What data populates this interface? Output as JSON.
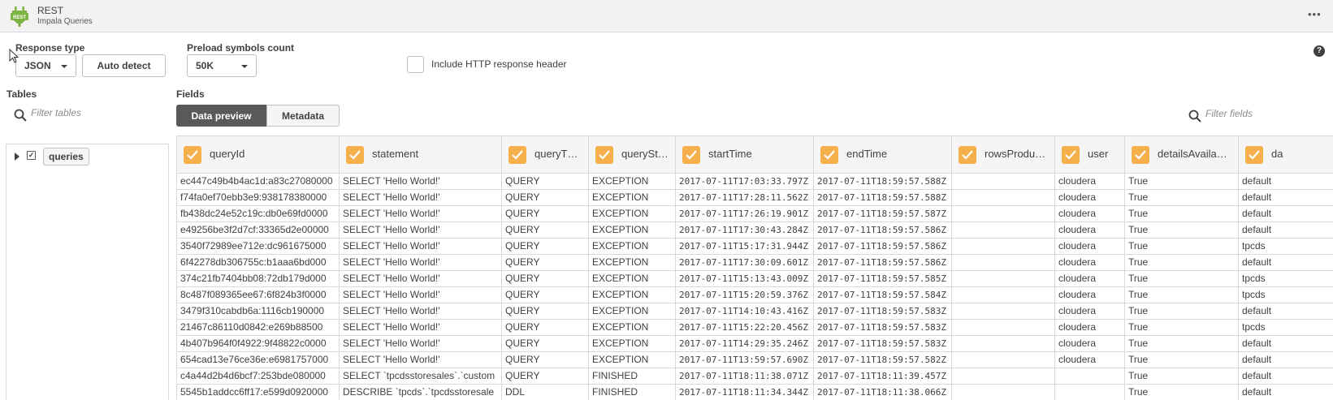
{
  "app": {
    "logo_text": "REST",
    "title": "REST",
    "subtitle": "Impala Queries",
    "more": "•••"
  },
  "options": {
    "response_type_label": "Response type",
    "response_type_value": "JSON",
    "auto_detect_label": "Auto detect",
    "preload_label": "Preload symbols count",
    "preload_value": "50K",
    "include_header_label": "Include HTTP response header",
    "help": "?"
  },
  "tables": {
    "label": "Tables",
    "filter_placeholder": "Filter tables",
    "items": [
      {
        "name": "queries",
        "checked_mark": "✓"
      }
    ]
  },
  "fields": {
    "label": "Fields",
    "tabs": [
      "Data preview",
      "Metadata"
    ],
    "filter_placeholder": "Filter fields",
    "columns": [
      "queryId",
      "statement",
      "queryT…",
      "querySt…",
      "startTime",
      "endTime",
      "rowsProdu…",
      "user",
      "detailsAvaila…",
      "da"
    ],
    "rows": [
      [
        "ec447c49b4b4ac1d:a83c27080000",
        "SELECT 'Hello World!'",
        "QUERY",
        "EXCEPTION",
        "2017-07-11T17:03:33.797Z",
        "2017-07-11T18:59:57.588Z",
        "",
        "cloudera",
        "True",
        "default"
      ],
      [
        "f74fa0ef70ebb3e9:938178380000",
        "SELECT 'Hello World!'",
        "QUERY",
        "EXCEPTION",
        "2017-07-11T17:28:11.562Z",
        "2017-07-11T18:59:57.588Z",
        "",
        "cloudera",
        "True",
        "default"
      ],
      [
        "fb438dc24e52c19c:db0e69fd0000",
        "SELECT 'Hello World!'",
        "QUERY",
        "EXCEPTION",
        "2017-07-11T17:26:19.901Z",
        "2017-07-11T18:59:57.587Z",
        "",
        "cloudera",
        "True",
        "default"
      ],
      [
        "e49256be3f2d7cf:33365d2e00000",
        "SELECT 'Hello World!'",
        "QUERY",
        "EXCEPTION",
        "2017-07-11T17:30:43.284Z",
        "2017-07-11T18:59:57.586Z",
        "",
        "cloudera",
        "True",
        "default"
      ],
      [
        "3540f72989ee712e:dc961675000",
        "SELECT 'Hello World!'",
        "QUERY",
        "EXCEPTION",
        "2017-07-11T15:17:31.944Z",
        "2017-07-11T18:59:57.586Z",
        "",
        "cloudera",
        "True",
        "tpcds"
      ],
      [
        "6f42278db306755c:b1aaa6bd000",
        "SELECT 'Hello World!'",
        "QUERY",
        "EXCEPTION",
        "2017-07-11T17:30:09.601Z",
        "2017-07-11T18:59:57.586Z",
        "",
        "cloudera",
        "True",
        "default"
      ],
      [
        "374c21fb7404bb08:72db179d000",
        "SELECT 'Hello World!'",
        "QUERY",
        "EXCEPTION",
        "2017-07-11T15:13:43.009Z",
        "2017-07-11T18:59:57.585Z",
        "",
        "cloudera",
        "True",
        "tpcds"
      ],
      [
        "8c487f089365ee67:6f824b3f0000",
        "SELECT 'Hello World!'",
        "QUERY",
        "EXCEPTION",
        "2017-07-11T15:20:59.376Z",
        "2017-07-11T18:59:57.584Z",
        "",
        "cloudera",
        "True",
        "tpcds"
      ],
      [
        "3479f310cabdb6a:1116cb190000",
        "SELECT 'Hello World!'",
        "QUERY",
        "EXCEPTION",
        "2017-07-11T14:10:43.416Z",
        "2017-07-11T18:59:57.583Z",
        "",
        "cloudera",
        "True",
        "default"
      ],
      [
        "21467c86110d0842:e269b88500",
        "SELECT 'Hello World!'",
        "QUERY",
        "EXCEPTION",
        "2017-07-11T15:22:20.456Z",
        "2017-07-11T18:59:57.583Z",
        "",
        "cloudera",
        "True",
        "tpcds"
      ],
      [
        "4b407b964f0f4922:9f48822c0000",
        "SELECT 'Hello World!'",
        "QUERY",
        "EXCEPTION",
        "2017-07-11T14:29:35.246Z",
        "2017-07-11T18:59:57.583Z",
        "",
        "cloudera",
        "True",
        "default"
      ],
      [
        "654cad13e76ce36e:e6981757000",
        "SELECT 'Hello World!'",
        "QUERY",
        "EXCEPTION",
        "2017-07-11T13:59:57.690Z",
        "2017-07-11T18:59:57.582Z",
        "",
        "cloudera",
        "True",
        "default"
      ],
      [
        "c4a44d2b4d6bcf7:253bde080000",
        "SELECT `tpcdsstoresales`.`custom",
        "QUERY",
        "FINISHED",
        "2017-07-11T18:11:38.071Z",
        "2017-07-11T18:11:39.457Z",
        "",
        "",
        "True",
        "default"
      ],
      [
        "5545b1addcc6ff17:e599d0920000",
        "DESCRIBE `tpcds`.`tpcdsstoresale",
        "DDL",
        "FINISHED",
        "2017-07-11T18:11:34.344Z",
        "2017-07-11T18:11:38.066Z",
        "",
        "",
        "True",
        "default"
      ]
    ]
  },
  "colors": {
    "accent_orange": "#f6b04b",
    "tab_active": "#595959",
    "header_bg": "#f2f2f2",
    "logo_green": "#7cb342"
  }
}
